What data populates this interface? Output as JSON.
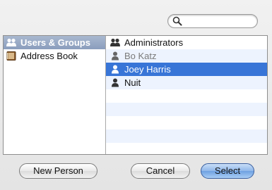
{
  "search": {
    "placeholder": "",
    "value": ""
  },
  "sources": [
    {
      "label": "Users & Groups",
      "icon": "group-icon",
      "selected": true
    },
    {
      "label": "Address Book",
      "icon": "address-book-icon",
      "selected": false
    }
  ],
  "items": [
    {
      "label": "Administrators",
      "icon": "group-icon",
      "dimmed": false,
      "selected": false
    },
    {
      "label": "Bo Katz",
      "icon": "person-icon",
      "dimmed": true,
      "selected": false
    },
    {
      "label": "Joey Harris",
      "icon": "person-icon",
      "dimmed": false,
      "selected": true
    },
    {
      "label": "Nuit",
      "icon": "person-icon",
      "dimmed": false,
      "selected": false
    }
  ],
  "buttons": {
    "new_person": "New Person",
    "cancel": "Cancel",
    "select": "Select"
  },
  "colors": {
    "selection": "#3875d7",
    "source_selection": "#8a9dbd",
    "stripe": "#edf3fe"
  }
}
